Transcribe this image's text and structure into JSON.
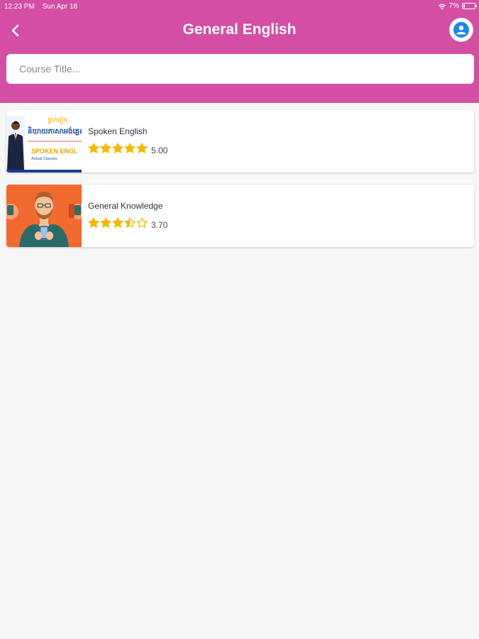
{
  "status": {
    "time": "12:23 PM",
    "date": "Sun Apr 18",
    "battery": "7%",
    "battery_level": 0.07
  },
  "header": {
    "title": "General English",
    "back_icon": "chevron-left-icon",
    "profile_icon": "person-icon"
  },
  "search": {
    "placeholder": "Course Title...",
    "value": ""
  },
  "courses": [
    {
      "title": "Spoken English",
      "rating": 5.0,
      "rating_text": "5.00",
      "thumbnail": {
        "khmer_line1": "ថ្នាក់រៀន",
        "khmer_line2": "និយាយភាសាអង់គ្លេស",
        "label": "SPOKEN ENGL",
        "sublabel": "Actual Classes"
      }
    },
    {
      "title": "General Knowledge",
      "rating": 3.7,
      "rating_text": "3.70"
    }
  ],
  "colors": {
    "header": "#d44fa4",
    "star": "#f5b800",
    "background": "#f7f7f7"
  }
}
